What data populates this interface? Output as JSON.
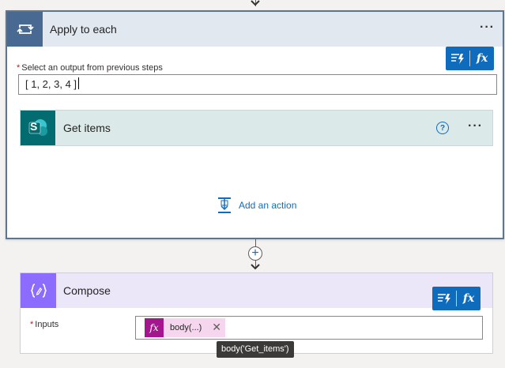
{
  "apply_to_each": {
    "title": "Apply to each",
    "more_label": "···",
    "select_output_label": "Select an output from previous steps",
    "required_mark": "*",
    "array_value": "[ 1,  2, 3,  4 ]"
  },
  "get_items": {
    "title": "Get items",
    "help_label": "?",
    "more_label": "···",
    "icon_letter": "S"
  },
  "add_action": {
    "label": "Add an action"
  },
  "insert_step": {
    "label": "+"
  },
  "compose": {
    "title": "Compose",
    "inputs_label": "Inputs",
    "required_mark": "*",
    "token_fx": "fx",
    "token_label": "body(...)",
    "token_remove": "✕",
    "tooltip": "body('Get_items')"
  },
  "dynamic_buttons": {
    "fx_label": "fx"
  },
  "colors": {
    "loop_accent": "#486991",
    "sharepoint": "#036c70",
    "compose_accent": "#8c6cff",
    "primary": "#0f6cbd",
    "expression_token": "#a4168e"
  },
  "icons": {
    "loop": "loop-icon",
    "sharepoint": "sharepoint-icon",
    "compose": "compose-braces-icon",
    "dynamic_content": "dynamic-content-icon",
    "expression": "fx-icon",
    "add_action": "add-action-icon",
    "help": "help-icon"
  }
}
